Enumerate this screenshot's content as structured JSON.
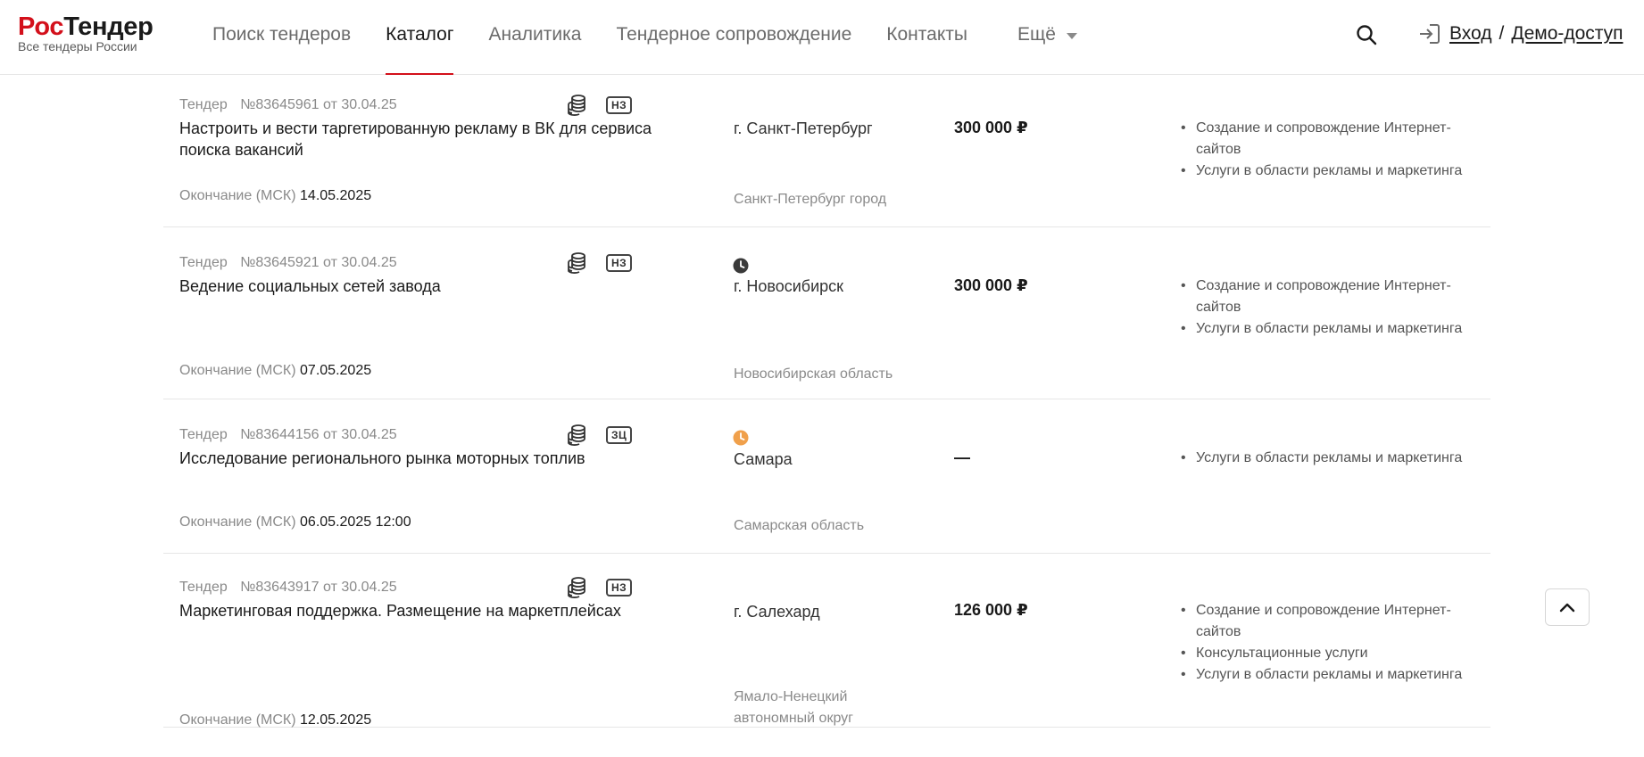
{
  "header": {
    "logo_part1": "Рос",
    "logo_part2": "Тендер",
    "logo_subtitle": "Все тендеры России",
    "nav": [
      "Поиск тендеров",
      "Каталог",
      "Аналитика",
      "Тендерное сопровождение",
      "Контакты"
    ],
    "nav_active_index": 1,
    "more_label": "Ещё",
    "login_label": "Вход",
    "separator": "/",
    "demo_label": "Демо-доступ",
    "icons": {
      "search": "search-icon",
      "login": "login-icon",
      "more": "chevron-down-icon"
    }
  },
  "colors": {
    "brand_red": "#d3101b",
    "clock_dark": "#3a3a3a",
    "clock_orange": "#f0a04b"
  },
  "tender_label": "Тендер",
  "deadline_label": "Окончание (МСК)",
  "tenders": [
    {
      "number": "№83645961",
      "date": "от 30.04.25",
      "badge": "НЗ",
      "title": "Настроить и вести таргетированную рекламу в ВК для сервиса поиска вакансий",
      "deadline_date": "14.05.2025",
      "deadline_time": "",
      "clock": "",
      "city": "г. Санкт-Петербург",
      "region": "Санкт-Петербург город",
      "price": "300 000 ₽",
      "categories": [
        "Создание и сопровождение Интернет-сайтов",
        "Услуги в области рекламы и маркетинга"
      ]
    },
    {
      "number": "№83645921",
      "date": "от 30.04.25",
      "badge": "НЗ",
      "title": "Ведение социальных сетей завода",
      "deadline_date": "07.05.2025",
      "deadline_time": "",
      "clock": "dark",
      "city": "г. Новосибирск",
      "region": "Новосибирская область",
      "price": "300 000 ₽",
      "categories": [
        "Создание и сопровождение Интернет-сайтов",
        "Услуги в области рекламы и маркетинга"
      ]
    },
    {
      "number": "№83644156",
      "date": "от 30.04.25",
      "badge": "ЗЦ",
      "title": "Исследование регионального рынка моторных топлив",
      "deadline_date": "06.05.2025",
      "deadline_time": "12:00",
      "clock": "orange",
      "city": "Самара",
      "region": "Самарская область",
      "price": "—",
      "categories": [
        "Услуги в области рекламы и маркетинга"
      ]
    },
    {
      "number": "№83643917",
      "date": "от 30.04.25",
      "badge": "НЗ",
      "title": "Маркетинговая поддержка. Размещение на маркетплейсах",
      "deadline_date": "12.05.2025",
      "deadline_time": "",
      "clock": "",
      "city": "г. Салехард",
      "region": "Ямало-Ненецкий автономный округ",
      "price": "126 000 ₽",
      "categories": [
        "Создание и сопровождение Интернет-сайтов",
        "Консультационные услуги",
        "Услуги в области рекламы и маркетинга"
      ]
    }
  ],
  "scroll_top_icon": "chevron-up-icon"
}
